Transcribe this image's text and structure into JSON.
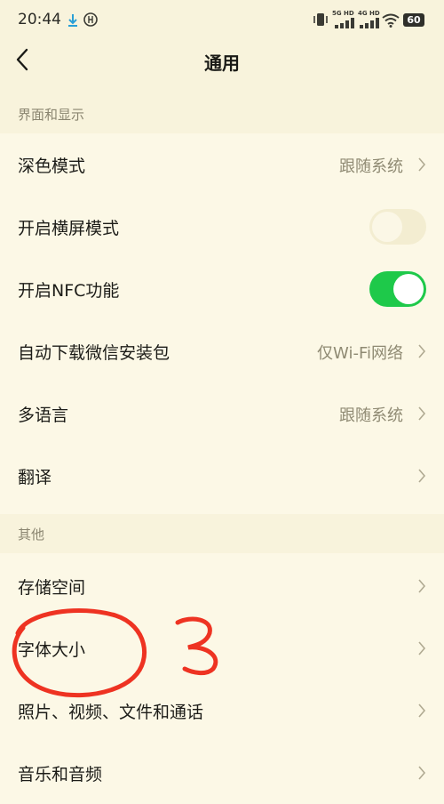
{
  "status_bar": {
    "time": "20:44",
    "network_5g": "5G HD",
    "network_4g": "4G HD",
    "battery": "60"
  },
  "nav": {
    "title": "通用"
  },
  "sections": {
    "display": {
      "header": "界面和显示",
      "dark_mode": {
        "label": "深色模式",
        "value": "跟随系统"
      },
      "landscape": {
        "label": "开启横屏模式",
        "enabled": false
      },
      "nfc": {
        "label": "开启NFC功能",
        "enabled": true
      },
      "auto_download": {
        "label": "自动下载微信安装包",
        "value": "仅Wi-Fi网络"
      },
      "language": {
        "label": "多语言",
        "value": "跟随系统"
      },
      "translate": {
        "label": "翻译"
      }
    },
    "other": {
      "header": "其他",
      "storage": {
        "label": "存储空间"
      },
      "font_size": {
        "label": "字体大小"
      },
      "media": {
        "label": "照片、视频、文件和通话"
      },
      "music": {
        "label": "音乐和音频"
      }
    }
  },
  "annotation": {
    "mark": "3",
    "color": "#ee3322"
  },
  "colors": {
    "background": "#fcf8e6",
    "section_bg": "#f8f3dc",
    "toggle_on": "#1ec94a",
    "toggle_off": "#f3edd1",
    "secondary_text": "#8f8a73"
  }
}
